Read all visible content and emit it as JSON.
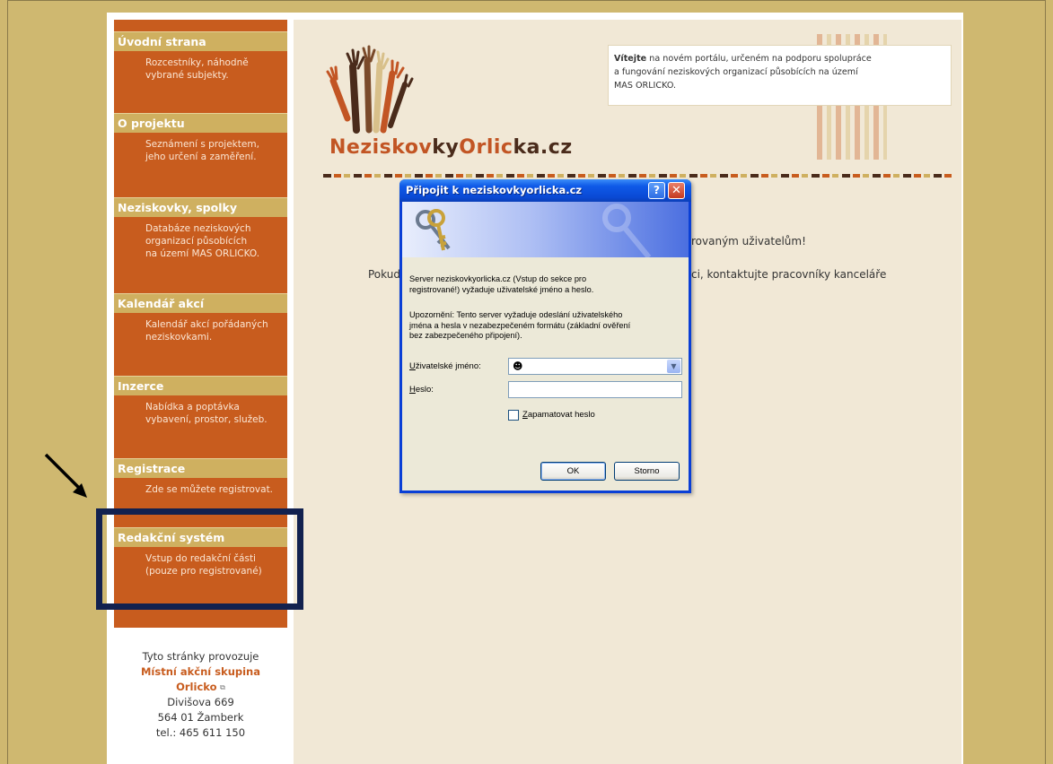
{
  "logo": {
    "part1": "Neziskov",
    "part2": "ky",
    "part3": "Orlic",
    "part4": "ka.cz"
  },
  "welcome": {
    "bold": "Vítejte",
    "line1_rest": " na novém portálu, určeném na podporu spolupráce",
    "line2": "a fungování neziskových organizací působících na území",
    "line3": "MAS ORLICKO."
  },
  "sidebar": {
    "sections": [
      {
        "title": "Úvodní strana",
        "lines": [
          "Rozcestníky, náhodně",
          "vybrané subjekty."
        ]
      },
      {
        "title": "O projektu",
        "lines": [
          "Seznámení s projektem,",
          "jeho určení a zaměření."
        ]
      },
      {
        "title": "Neziskovky, spolky",
        "lines": [
          "Databáze neziskových",
          "organizací působících",
          "na území MAS ORLICKO."
        ]
      },
      {
        "title": "Kalendář akcí",
        "lines": [
          "Kalendář akcí pořádaných",
          "neziskovkami."
        ]
      },
      {
        "title": "Inzerce",
        "lines": [
          "Nabídka a poptávka",
          "vybavení, prostor, služeb."
        ]
      },
      {
        "title": "Registrace",
        "lines": [
          "Zde se můžete registrovat."
        ]
      },
      {
        "title": "Redakční systém",
        "lines": [
          "Vstup do redakční části",
          "(pouze pro registrované)"
        ]
      }
    ]
  },
  "footer": {
    "line1": "Tyto stránky provozuje",
    "org1": "Místní akční skupina",
    "org2": "Orlicko",
    "addr1": "Divišova 669",
    "addr2": "564 01 Žamberk",
    "phone": "tel.: 465 611 150"
  },
  "main": {
    "text1": "rovaným uživatelům!",
    "text2": "Pokud",
    "text3": "ci, kontaktujte pracovníky kanceláře"
  },
  "dialog": {
    "title": "Připojit k neziskovkyorlicka.cz",
    "help": "?",
    "close": "✕",
    "msg1a": "Server neziskovkyorlicka.cz (Vstup do sekce pro",
    "msg1b": "registrované!) vyžaduje uživatelské jméno a heslo.",
    "msg2a": "Upozornění: Tento server vyžaduje odeslání uživatelského",
    "msg2b": "jména a hesla v nezabezpečeném formátu (základní ověření",
    "msg2c": "bez zabezpečeného připojení).",
    "user_label_u": "U",
    "user_label_rest": "živatelské jméno:",
    "user_value": "",
    "pw_label_u": "H",
    "pw_label_rest": "eslo:",
    "remember_u": "Z",
    "remember_rest": "apamatovat heslo",
    "ok": "OK",
    "cancel": "Storno"
  }
}
